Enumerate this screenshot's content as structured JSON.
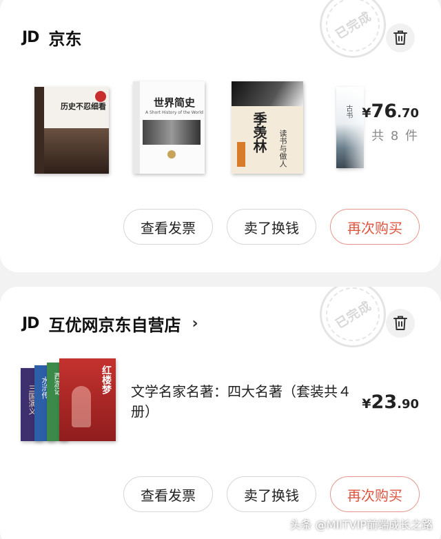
{
  "orders": [
    {
      "logo": "JD",
      "shop": "京东",
      "stamp": "已完成",
      "books": [
        {
          "title": "历史不忍细看",
          "spine": "历史不忍细看"
        },
        {
          "title": "世界简史",
          "subtitle": "A Short History of the World"
        },
        {
          "title": "季羡林 读书与做人",
          "name": "季羡林",
          "sub": "读书与做人"
        },
        {
          "title": "古书",
          "spine": "古书"
        }
      ],
      "price": {
        "yen": "¥",
        "int": "76",
        "dec": ".70"
      },
      "count": "共 8 件",
      "buttons": [
        "查看发票",
        "卖了换钱",
        "再次购买"
      ]
    },
    {
      "logo": "JD",
      "shop": "互优网京东自营店",
      "chevron": "›",
      "stamp": "已完成",
      "books": [
        {
          "title": "三国演义"
        },
        {
          "title": "水浒传"
        },
        {
          "title": "西游记"
        },
        {
          "title": "红楼梦"
        }
      ],
      "item_title": "文学名家名著：四大名著（套装共４册）",
      "price": {
        "yen": "¥",
        "int": "23",
        "dec": ".90"
      },
      "buttons": [
        "查看发票",
        "卖了换钱",
        "再次购买"
      ]
    }
  ],
  "watermark": "头条 @MIITVIP前端成长之路",
  "colors": {
    "accent": "#e0533f",
    "accent_border": "#e6968c",
    "background": "#f2f2f2"
  }
}
